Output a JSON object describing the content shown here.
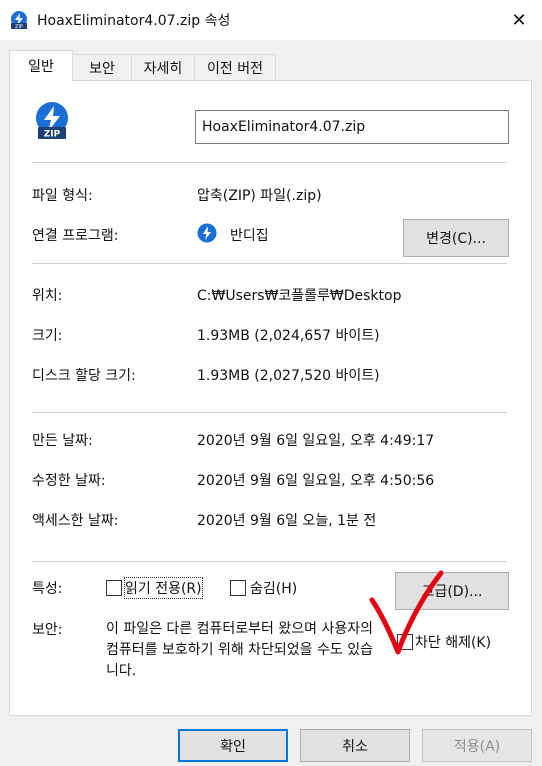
{
  "window": {
    "title": "HoaxEliminator4.07.zip 속성",
    "close_glyph": "✕"
  },
  "tabs": [
    {
      "label": "일반",
      "active": true
    },
    {
      "label": "보안",
      "active": false
    },
    {
      "label": "자세히",
      "active": false
    },
    {
      "label": "이전 버전",
      "active": false
    }
  ],
  "general": {
    "filename": "HoaxEliminator4.07.zip",
    "file_type_label": "파일 형식:",
    "file_type_value": "압축(ZIP) 파일(.zip)",
    "open_with_label": "연결 프로그램:",
    "open_with_value": "반디집",
    "change_button": "변경(C)...",
    "location_label": "위치:",
    "location_value": "C:₩Users₩코플롤루₩Desktop",
    "size_label": "크기:",
    "size_value": "1.93MB (2,024,657 바이트)",
    "disk_size_label": "디스크 할당 크기:",
    "disk_size_value": "1.93MB (2,027,520 바이트)",
    "created_label": "만든 날짜:",
    "created_value": "2020년 9월 6일 일요일, 오후 4:49:17",
    "modified_label": "수정한 날짜:",
    "modified_value": "2020년 9월 6일 일요일, 오후 4:50:56",
    "accessed_label": "액세스한 날짜:",
    "accessed_value": "2020년 9월 6일 오늘, 1분 전",
    "attributes_label": "특성:",
    "readonly_label": "읽기 전용(R)",
    "hidden_label": "숨김(H)",
    "advanced_button": "고급(D)...",
    "security_label": "보안:",
    "security_text": "이 파일은 다른 컴퓨터로부터 왔으며 사용자의 컴퓨터를 보호하기 위해 차단되었을 수도 있습니다.",
    "unblock_label": "차단 해제(K)"
  },
  "footer": {
    "ok": "확인",
    "cancel": "취소",
    "apply": "적용(A)"
  },
  "colors": {
    "icon_blue": "#1a6fd6",
    "annotation_red": "#e60012",
    "focus_border": "#0078d7"
  }
}
